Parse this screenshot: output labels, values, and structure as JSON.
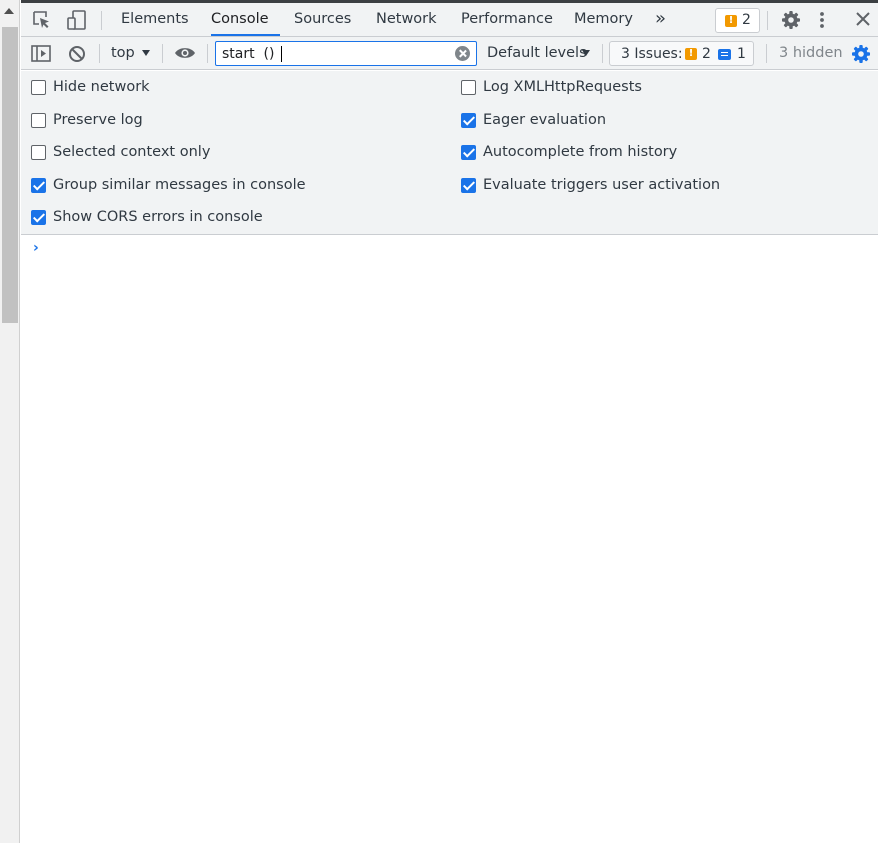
{
  "tabs": [
    {
      "label": "Elements",
      "active": false
    },
    {
      "label": "Console",
      "active": true
    },
    {
      "label": "Sources",
      "active": false
    },
    {
      "label": "Network",
      "active": false
    },
    {
      "label": "Performance",
      "active": false
    },
    {
      "label": "Memory",
      "active": false
    }
  ],
  "more_tabs_glyph": "»",
  "issue_badge": {
    "icon": "warning-icon",
    "count": "2"
  },
  "toolbar": {
    "context": "top",
    "filter": {
      "value": "start  ()",
      "placeholder": "Filter"
    },
    "levels": "Default levels",
    "issues": {
      "label": "3 Issues:",
      "warnings": "2",
      "info": "1"
    },
    "hidden": "3 hidden"
  },
  "settings": {
    "left": [
      {
        "label": "Hide network",
        "checked": false
      },
      {
        "label": "Preserve log",
        "checked": false
      },
      {
        "label": "Selected context only",
        "checked": false
      },
      {
        "label": "Group similar messages in console",
        "checked": true
      },
      {
        "label": "Show CORS errors in console",
        "checked": true
      }
    ],
    "right": [
      {
        "label": "Log XMLHttpRequests",
        "checked": false
      },
      {
        "label": "Eager evaluation",
        "checked": true
      },
      {
        "label": "Autocomplete from history",
        "checked": true
      },
      {
        "label": "Evaluate triggers user activation",
        "checked": true
      }
    ]
  },
  "console": {
    "prompt": "›"
  },
  "colors": {
    "accent": "#1a73e8",
    "warning": "#f29900",
    "toolbar_bg": "#f1f3f4"
  }
}
